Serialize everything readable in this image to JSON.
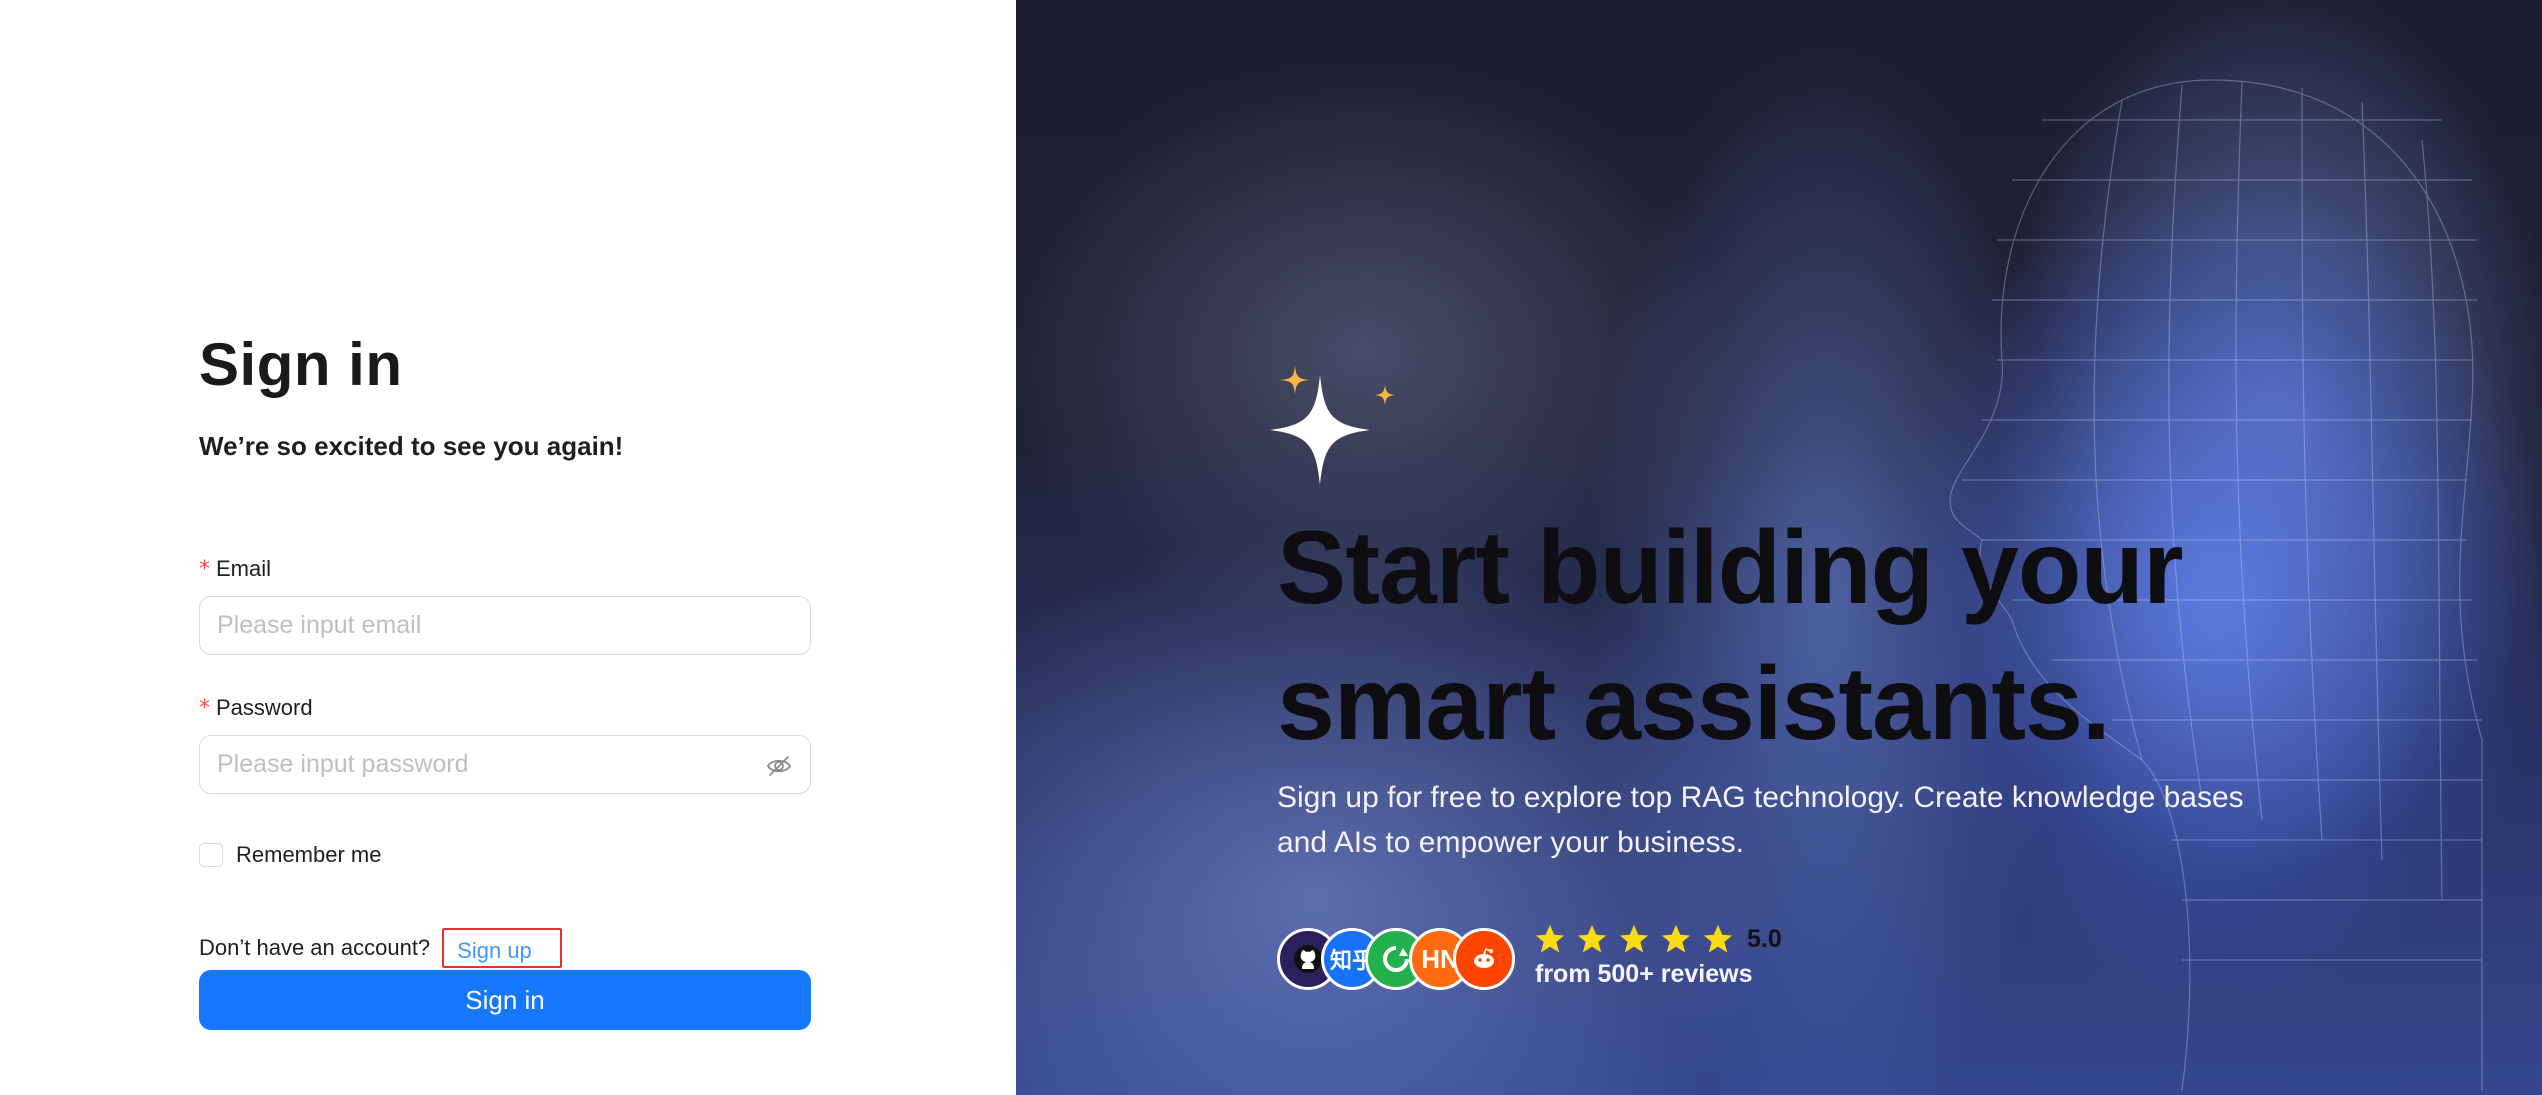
{
  "signin": {
    "title": "Sign in",
    "subtitle": "We’re so excited to see you again!",
    "email_label": "Email",
    "email_placeholder": "Please input email",
    "password_label": "Password",
    "password_placeholder": "Please input password",
    "remember_label": "Remember me",
    "no_account_text": "Don’t have an account?",
    "signup_link": "Sign up",
    "signin_button": "Sign in",
    "required_mark": "*"
  },
  "promo": {
    "headline": "Start building your smart assistants.",
    "description": "Sign up for free to explore top RAG technology. Create knowledge bases and AIs to empower your business.",
    "rating": "5.0",
    "reviews": "from 500+ reviews",
    "stars_count": 5,
    "avatars": [
      {
        "name": "github-avatar",
        "text": "",
        "color": "#2b1f5e"
      },
      {
        "name": "zhihu-avatar",
        "text": "知乎",
        "color": "#1772f6"
      },
      {
        "name": "wechat-avatar",
        "text": "",
        "color": "#22b14c"
      },
      {
        "name": "hackernews-avatar",
        "text": "HN",
        "color": "#ff6a10"
      },
      {
        "name": "reddit-avatar",
        "text": "",
        "color": "#ff4500"
      }
    ],
    "star_color": "#fadb14",
    "sparkle_accent": "#f5b942"
  },
  "colors": {
    "primary": "#1677ff",
    "link": "#4096ff",
    "required": "#ff4d4f",
    "highlight_border": "#e5312f"
  }
}
